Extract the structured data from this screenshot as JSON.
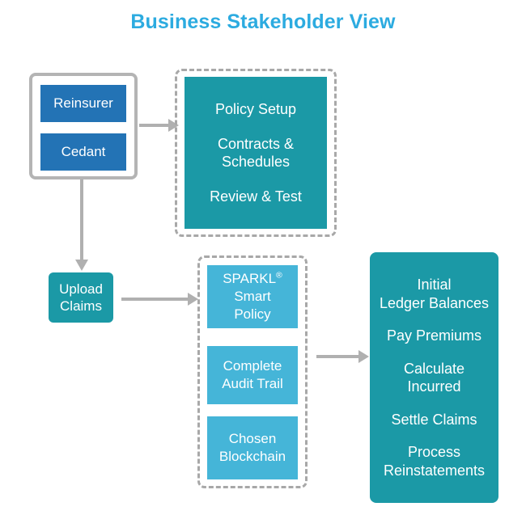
{
  "title": "Business Stakeholder View",
  "colors": {
    "title": "#2cabe0",
    "teal": "#1b99a6",
    "light_blue": "#45b5d8",
    "blue": "#2373b5",
    "gray_border": "#b4b4b4",
    "dashed_border": "#a8a8a8",
    "arrow": "#b0b0b0",
    "background": "#ffffff"
  },
  "actors": {
    "group_label": "stakeholder-actors",
    "items": [
      {
        "label": "Reinsurer"
      },
      {
        "label": "Cedant"
      }
    ]
  },
  "policy_stage": {
    "lines": [
      "Policy Setup",
      "Contracts &",
      "Schedules",
      "Review & Test"
    ],
    "rows": [
      {
        "text": "Policy Setup"
      },
      {
        "text": "Contracts &"
      },
      {
        "text": "Schedules"
      },
      {
        "text": "Review & Test"
      }
    ]
  },
  "upload": {
    "line1": "Upload",
    "line2": "Claims"
  },
  "platform": {
    "cards": [
      {
        "name": "sparkl-smart-policy",
        "line1": "SPARKL",
        "mark": "®",
        "line2": "Smart",
        "line3": "Policy"
      },
      {
        "name": "complete-audit-trail",
        "line1": "Complete",
        "line2": "Audit Trail"
      },
      {
        "name": "chosen-blockchain",
        "line1": "Chosen",
        "line2": "Blockchain"
      }
    ]
  },
  "ledger_stage": {
    "rows": [
      {
        "line1": "Initial",
        "line2": "Ledger Balances"
      },
      {
        "line1": "Pay Premiums",
        "line2": ""
      },
      {
        "line1": "Calculate",
        "line2": "Incurred"
      },
      {
        "line1": "Settle Claims",
        "line2": ""
      },
      {
        "line1": "Process",
        "line2": "Reinstatements"
      }
    ]
  },
  "arrows": [
    {
      "name": "arrow-actors-to-policy",
      "direction": "right"
    },
    {
      "name": "arrow-actors-to-upload",
      "direction": "down"
    },
    {
      "name": "arrow-upload-to-platform",
      "direction": "right"
    },
    {
      "name": "arrow-platform-to-ledger",
      "direction": "right"
    }
  ]
}
